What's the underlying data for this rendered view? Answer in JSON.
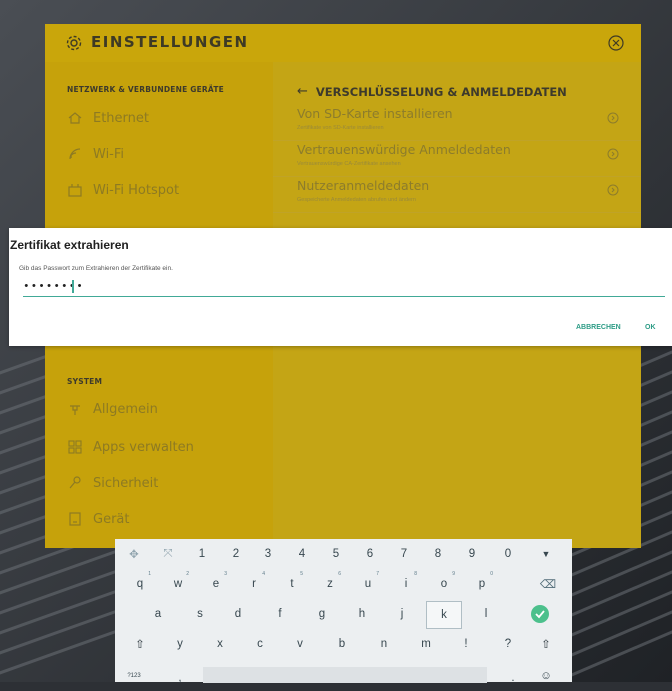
{
  "header": {
    "title": "EINSTELLUNGEN"
  },
  "sidebar": {
    "section_network": "NETZWERK & VERBUNDENE GERÄTE",
    "items_network": [
      {
        "label": "Ethernet",
        "icon": "home-icon"
      },
      {
        "label": "Wi-Fi",
        "icon": "wifi-icon"
      },
      {
        "label": "Wi-Fi Hotspot",
        "icon": "hotspot-icon"
      }
    ],
    "section_system": "SYSTEM",
    "items_system": [
      {
        "label": "Allgemein",
        "icon": "general-icon"
      },
      {
        "label": "Apps verwalten",
        "icon": "apps-icon"
      },
      {
        "label": "Sicherheit",
        "icon": "key-icon"
      },
      {
        "label": "Gerät",
        "icon": "device-icon"
      }
    ]
  },
  "panel": {
    "title": "VERSCHLÜSSELUNG & ANMELDEDATEN",
    "items": [
      {
        "title": "Von SD-Karte installieren",
        "subtitle": "Zertifikate von SD-Karte installieren"
      },
      {
        "title": "Vertrauenswürdige Anmeldedaten",
        "subtitle": "Vertrauenswürdige CA-Zertifikate ansehen"
      },
      {
        "title": "Nutzeranmeldedaten",
        "subtitle": "Gespeicherte Anmeldedaten abrufen und ändern"
      }
    ]
  },
  "dialog": {
    "title": "Zertifikat extrahieren",
    "message": "Gib das Passwort zum Extrahieren der Zertifikate ein.",
    "password_value": "••••••••",
    "cancel_label": "ABBRECHEN",
    "ok_label": "OK",
    "accent_color": "#2d9c86"
  },
  "keyboard": {
    "row1": [
      "1",
      "2",
      "3",
      "4",
      "5",
      "6",
      "7",
      "8",
      "9",
      "0"
    ],
    "row2": [
      {
        "k": "q",
        "s": "1"
      },
      {
        "k": "w",
        "s": "2"
      },
      {
        "k": "e",
        "s": "3"
      },
      {
        "k": "r",
        "s": "4"
      },
      {
        "k": "t",
        "s": "5"
      },
      {
        "k": "z",
        "s": "6"
      },
      {
        "k": "u",
        "s": "7"
      },
      {
        "k": "i",
        "s": "8"
      },
      {
        "k": "o",
        "s": "9"
      },
      {
        "k": "p",
        "s": "0"
      }
    ],
    "row3": [
      "a",
      "s",
      "d",
      "f",
      "g",
      "h",
      "j",
      "k",
      "l"
    ],
    "row4": [
      "y",
      "x",
      "c",
      "v",
      "b",
      "n",
      "m",
      "!",
      "?"
    ],
    "symbols_label": "?123",
    "comma": ",",
    "period": ".",
    "emoji": "☺",
    "backspace": "⌫",
    "hide": "▼",
    "shift": "⇧",
    "enter": "✓"
  }
}
